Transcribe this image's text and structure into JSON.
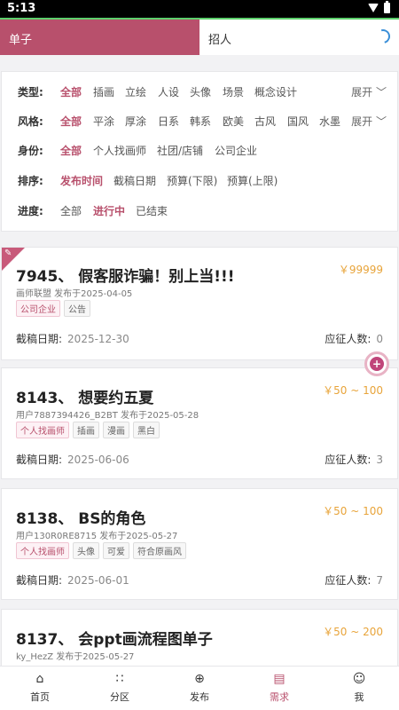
{
  "status": {
    "time": "5:13"
  },
  "tabs": {
    "left": "单子",
    "right": "招人"
  },
  "filters": {
    "type": {
      "label": "类型:",
      "options": [
        "全部",
        "插画",
        "立绘",
        "人设",
        "头像",
        "场景",
        "概念设计"
      ],
      "expand": "展开"
    },
    "style": {
      "label": "风格:",
      "options": [
        "全部",
        "平涂",
        "厚涂",
        "日系",
        "韩系",
        "欧美",
        "古风",
        "国风",
        "水墨"
      ],
      "expand": "展开"
    },
    "identity": {
      "label": "身份:",
      "options": [
        "全部",
        "个人找画师",
        "社团/店铺",
        "公司企业"
      ]
    },
    "sort": {
      "label": "排序:",
      "options": [
        "发布时间",
        "截稿日期",
        "预算(下限)",
        "预算(上限)"
      ]
    },
    "progress": {
      "label": "进度:",
      "options": [
        "全部",
        "进行中",
        "已结束"
      ]
    }
  },
  "cards": [
    {
      "title": "7945、 假客服诈骗！别上当!!!",
      "price": "￥99999",
      "meta": "画师联盟 发布于2025-04-05",
      "tags": [
        "公司企业",
        "公告"
      ],
      "deadline_label": "截稿日期:",
      "deadline": "2025-12-30",
      "applicants_label": "应征人数:",
      "applicants": "0"
    },
    {
      "title": "8143、 想要约五夏",
      "price": "￥50 ~ 100",
      "meta": "用户7887394426_B2BT 发布于2025-05-28",
      "tags": [
        "个人找画师",
        "插画",
        "漫画",
        "黑白"
      ],
      "deadline_label": "截稿日期:",
      "deadline": "2025-06-06",
      "applicants_label": "应征人数:",
      "applicants": "3"
    },
    {
      "title": "8138、 BS的角色",
      "price": "￥50 ~ 100",
      "meta": "用户130R0RE8715 发布于2025-05-27",
      "tags": [
        "个人找画师",
        "头像",
        "可爱",
        "符合原画风"
      ],
      "deadline_label": "截稿日期:",
      "deadline": "2025-06-01",
      "applicants_label": "应征人数:",
      "applicants": "7"
    },
    {
      "title": "8137、 会ppt画流程图单子",
      "price": "￥50 ~ 200",
      "meta": "ky_HezZ 发布于2025-05-27"
    }
  ],
  "fab": {
    "symbol": "+"
  },
  "nav": [
    {
      "label": "首页",
      "icon": "⌂"
    },
    {
      "label": "分区",
      "icon": "∷"
    },
    {
      "label": "发布",
      "icon": "⊕"
    },
    {
      "label": "需求",
      "icon": "▤"
    },
    {
      "label": "我",
      "icon": "☺"
    }
  ]
}
